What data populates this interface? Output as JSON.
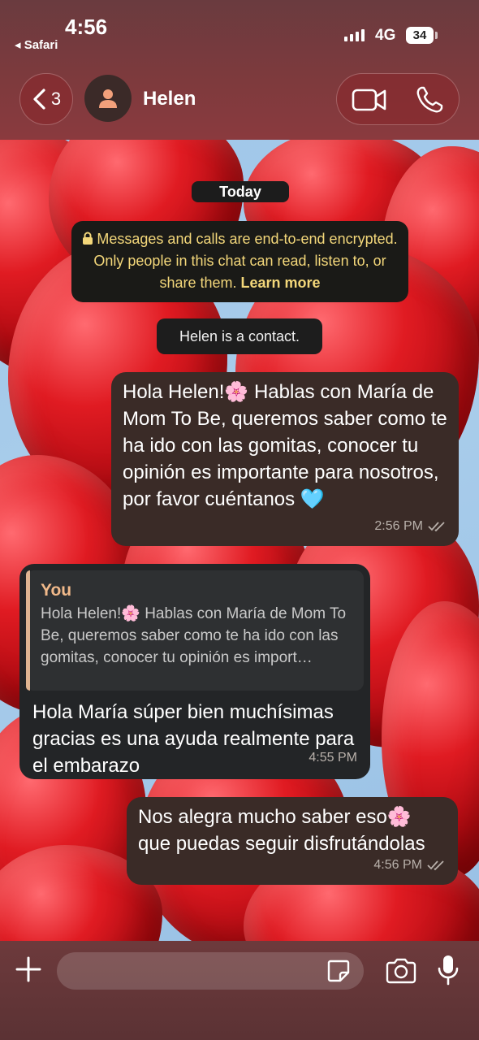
{
  "status_bar": {
    "time": "4:56",
    "back_app": "◂ Safari",
    "network": "4G",
    "battery": "34"
  },
  "header": {
    "back_count": "3",
    "contact_name": "Helen"
  },
  "chat": {
    "date_chip": "Today",
    "encryption_notice": "Messages and calls are end-to-end encrypted. Only people in this chat can read, listen to, or share them.",
    "learn_more": "Learn more",
    "contact_notice": "Helen is a contact.",
    "messages": [
      {
        "direction": "outgoing",
        "text": "Hola Helen!🌸 Hablas con María de Mom To Be, queremos saber como te ha ido con las gomitas, conocer tu opinión es importante para nosotros, por favor cuéntanos 🩵",
        "time": "2:56 PM",
        "status": "read"
      },
      {
        "direction": "incoming",
        "quote_author": "You",
        "quote_text": "Hola Helen!🌸 Hablas con María de Mom To Be, queremos saber como te ha ido con las gomitas, conocer tu opinión es import…",
        "text": "Hola María súper bien muchísimas gracias es una ayuda realmente para el embarazo",
        "time": "4:55 PM"
      },
      {
        "direction": "outgoing",
        "text": "Nos alegra mucho saber eso🌸 que puedas seguir disfrutándolas",
        "time": "4:56 PM",
        "status": "read"
      }
    ]
  },
  "composer": {
    "placeholder": ""
  },
  "icons": [
    "chevron-left-icon",
    "person-icon",
    "video-icon",
    "phone-icon",
    "lock-icon",
    "double-check-icon",
    "plus-icon",
    "sticker-icon",
    "camera-icon",
    "mic-icon"
  ]
}
